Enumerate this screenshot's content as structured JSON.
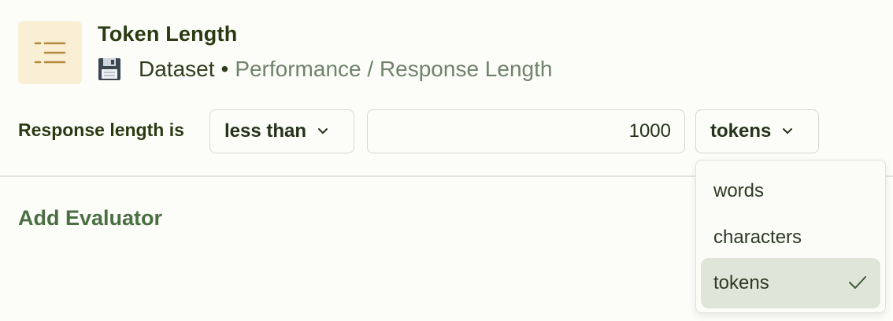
{
  "header": {
    "title": "Token Length",
    "icon": "list-lines-icon",
    "source_icon": "floppy-disk-icon",
    "source": "Dataset",
    "separator": "•",
    "path": "Performance / Response Length"
  },
  "condition": {
    "label": "Response length is",
    "operator": "less than",
    "value": "1000",
    "unit": "tokens"
  },
  "add_evaluator_label": "Add Evaluator",
  "unit_dropdown": {
    "options": [
      "words",
      "characters",
      "tokens"
    ],
    "selected": "tokens"
  },
  "colors": {
    "accent": "#4a6f42",
    "icon_tile": "#f8efd4",
    "selected_option": "#dfe5d8"
  }
}
